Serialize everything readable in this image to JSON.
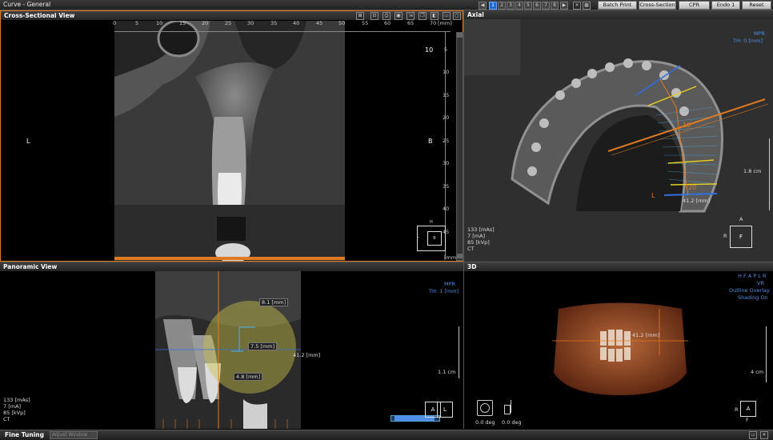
{
  "titlebar": {
    "title": "Curve - General",
    "nav_pages": [
      "1",
      "2",
      "3",
      "4",
      "5",
      "6",
      "7",
      "8"
    ],
    "buttons": [
      "Batch Print",
      "Cross-Section",
      "CPR",
      "Endo 1",
      "Reset"
    ]
  },
  "cross_section": {
    "header": "Cross-Sectional View",
    "top_ruler": [
      "0",
      "5",
      "10",
      "15",
      "20",
      "25",
      "30",
      "35",
      "40",
      "45",
      "50",
      "55",
      "60",
      "65",
      "70"
    ],
    "top_unit": "[mm]",
    "right_ruler": [
      "5",
      "10",
      "15",
      "20",
      "25",
      "30",
      "35",
      "40",
      "45"
    ],
    "right_unit": "[mm]",
    "slice_number": "10",
    "left_label": "L",
    "right_label": "B",
    "mini_top": "H",
    "mini_left": "L",
    "mini_center": "B"
  },
  "axial": {
    "header": "Axial",
    "mpr": "MPR",
    "thickness": "TH: 0 [mm]",
    "scale": "1.8 cm",
    "length": "41.2 [mm]",
    "marker_10": "10",
    "marker_20": "20",
    "marker_L": "L",
    "info": [
      "133 [mAs]",
      "7 [mA]",
      "85 [kVp]",
      "CT"
    ],
    "orient_top": "A",
    "orient_left": "R",
    "orient_center": "F"
  },
  "panoramic": {
    "header": "Panoramic View",
    "mpr": "MPR",
    "thickness": "TH: 1 [mm]",
    "scale": "1.1 cm",
    "measure_1": "8.1 [mm]",
    "measure_2": "7.5 [mm]",
    "measure_3": "41.2 [mm]",
    "measure_4": "4.8 [mm]",
    "info": [
      "133 [mAs]",
      "7 [mA]",
      "85 [kVp]",
      "CT"
    ],
    "orient_a": "A",
    "orient_l": "L"
  },
  "view3d": {
    "header": "3D",
    "orient_letters": "H F A P L R",
    "vr": "VR",
    "outline": "Outline Overlay",
    "shading": "Shading On",
    "scale": "4 cm",
    "measure": "41.2 [mm]",
    "rot1": "0.0 deg",
    "rot2": "0.0 deg",
    "orient_left": "R",
    "orient_center": "A",
    "orient_bottom": "F"
  },
  "statusbar": {
    "label": "Fine Tuning",
    "field": "Adjust Window"
  },
  "colors": {
    "accent_blue": "#1e6bd6",
    "measure_orange": "#e07a20",
    "info_blue": "#4f8fe8",
    "guide_yellow": "#e8d21a"
  }
}
